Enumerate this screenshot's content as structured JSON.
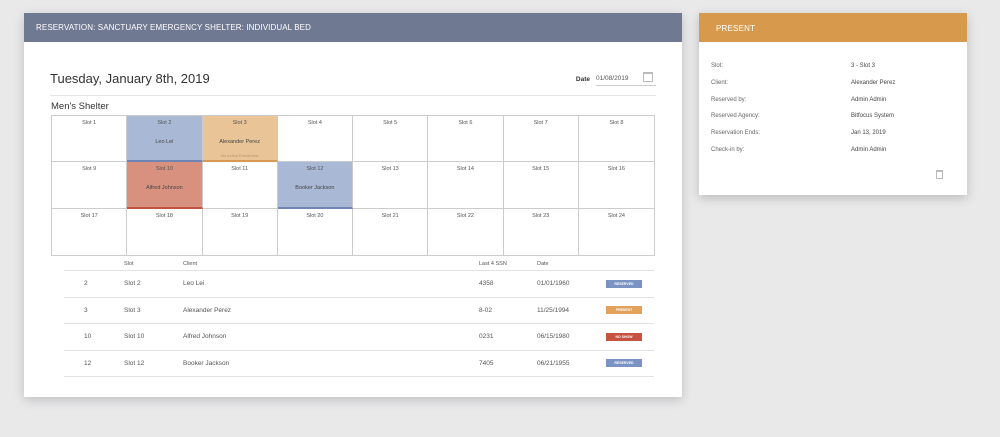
{
  "main": {
    "header": "Reservation: Sanctuary Emergency Shelter: Individual Bed",
    "big_date": "Tuesday, January 8th, 2019",
    "date_label": "Date",
    "date_value": "01/08/2019",
    "shelter_name": "Men's Shelter"
  },
  "slots": [
    {
      "label": "Slot 1",
      "client": "",
      "note": "",
      "status": ""
    },
    {
      "label": "Slot 2",
      "client": "Leo Lei",
      "note": "",
      "status": "reserved"
    },
    {
      "label": "Slot 3",
      "client": "Alexander Perez",
      "note": "No Active Enrollment",
      "status": "present"
    },
    {
      "label": "Slot 4",
      "client": "",
      "note": "",
      "status": ""
    },
    {
      "label": "Slot 5",
      "client": "",
      "note": "",
      "status": ""
    },
    {
      "label": "Slot 6",
      "client": "",
      "note": "",
      "status": ""
    },
    {
      "label": "Slot 7",
      "client": "",
      "note": "",
      "status": ""
    },
    {
      "label": "Slot 8",
      "client": "",
      "note": "",
      "status": ""
    },
    {
      "label": "Slot 9",
      "client": "",
      "note": "",
      "status": ""
    },
    {
      "label": "Slot 10",
      "client": "Alfred Johnson",
      "note": "",
      "status": "noshow"
    },
    {
      "label": "Slot 11",
      "client": "",
      "note": "",
      "status": ""
    },
    {
      "label": "Slot 12",
      "client": "Booker Jackson",
      "note": "",
      "status": "reserved"
    },
    {
      "label": "Slot 13",
      "client": "",
      "note": "",
      "status": ""
    },
    {
      "label": "Slot 14",
      "client": "",
      "note": "",
      "status": ""
    },
    {
      "label": "Slot 15",
      "client": "",
      "note": "",
      "status": ""
    },
    {
      "label": "Slot 16",
      "client": "",
      "note": "",
      "status": ""
    },
    {
      "label": "Slot 17",
      "client": "",
      "note": "",
      "status": ""
    },
    {
      "label": "Slot 18",
      "client": "",
      "note": "",
      "status": ""
    },
    {
      "label": "Slot 19",
      "client": "",
      "note": "",
      "status": ""
    },
    {
      "label": "Slot 20",
      "client": "",
      "note": "",
      "status": ""
    },
    {
      "label": "Slot 21",
      "client": "",
      "note": "",
      "status": ""
    },
    {
      "label": "Slot 22",
      "client": "",
      "note": "",
      "status": ""
    },
    {
      "label": "Slot 23",
      "client": "",
      "note": "",
      "status": ""
    },
    {
      "label": "Slot 24",
      "client": "",
      "note": "",
      "status": ""
    }
  ],
  "table": {
    "headers": {
      "slot": "Slot",
      "client": "Client",
      "ssn": "Last 4 SSN",
      "date": "Date"
    },
    "rows": [
      {
        "num": "2",
        "slot": "Slot 2",
        "client": "Leo Lei",
        "ssn": "4358",
        "date": "01/01/1960",
        "status": "Reserved",
        "status_key": "reserved"
      },
      {
        "num": "3",
        "slot": "Slot 3",
        "client": "Alexander Perez",
        "ssn": "8-02",
        "date": "11/25/1994",
        "status": "Present",
        "status_key": "present"
      },
      {
        "num": "10",
        "slot": "Slot 10",
        "client": "Alfred Johnson",
        "ssn": "0231",
        "date": "06/15/1980",
        "status": "No Show",
        "status_key": "noshow"
      },
      {
        "num": "12",
        "slot": "Slot 12",
        "client": "Booker Jackson",
        "ssn": "7405",
        "date": "06/21/1955",
        "status": "Reserved",
        "status_key": "reserved"
      }
    ]
  },
  "side": {
    "header": "Present",
    "details": [
      {
        "label": "Slot:",
        "value": "3 - Slot 3"
      },
      {
        "label": "Client:",
        "value": "Alexander Perez"
      },
      {
        "label": "Reserved by:",
        "value": "Admin Admin"
      },
      {
        "label": "Reserved Agency:",
        "value": "Bitfocus System"
      },
      {
        "label": "Reservation Ends:",
        "value": "Jan 13, 2019"
      },
      {
        "label": "Check-in by:",
        "value": "Admin Admin"
      }
    ]
  },
  "colors": {
    "reserved": "#7a93c3",
    "present": "#e3a25c",
    "noshow": "#c5533f"
  }
}
